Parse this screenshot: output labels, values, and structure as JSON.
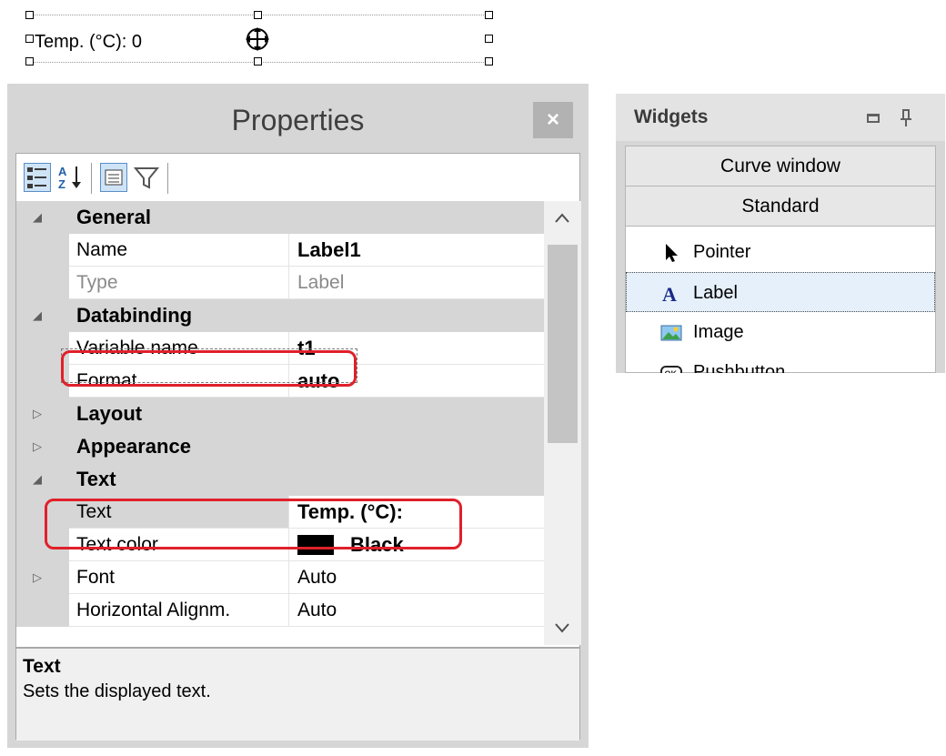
{
  "canvas": {
    "label_text": "Temp. (°C): 0"
  },
  "properties": {
    "title": "Properties",
    "close_glyph": "×",
    "toolbar": {
      "icons": [
        "categorized-icon",
        "alphabetical-sort-icon",
        "property-pages-icon",
        "filter-icon"
      ]
    },
    "categories": [
      {
        "label": "General",
        "expanded": true
      },
      {
        "label": "Databinding",
        "expanded": true
      },
      {
        "label": "Layout",
        "expanded": false
      },
      {
        "label": "Appearance",
        "expanded": false
      },
      {
        "label": "Text",
        "expanded": true
      }
    ],
    "rows": {
      "name": {
        "name": "Name",
        "value": "Label1"
      },
      "type": {
        "name": "Type",
        "value": "Label"
      },
      "variable_name": {
        "name": "Variable name",
        "value": "t1"
      },
      "format": {
        "name": "Format",
        "value": "auto"
      },
      "text": {
        "name": "Text",
        "value": "Temp. (°C):"
      },
      "text_color": {
        "name": "Text color",
        "value": "Black",
        "swatch": "#000000"
      },
      "font": {
        "name": "Font",
        "value": "Auto"
      },
      "halign": {
        "name": "Horizontal Alignm.",
        "value": "Auto"
      }
    },
    "description": {
      "title": "Text",
      "text": "Sets the displayed text."
    },
    "highlight_color": "#e0202a"
  },
  "widgets": {
    "title": "Widgets",
    "groups": [
      "Curve window",
      "Standard"
    ],
    "items": [
      {
        "label": "Pointer",
        "icon": "pointer-arrow-icon"
      },
      {
        "label": "Label",
        "icon": "label-a-icon",
        "selected": true
      },
      {
        "label": "Image",
        "icon": "image-icon"
      },
      {
        "label": "Pushbutton",
        "icon": "ok-button-icon"
      }
    ]
  }
}
